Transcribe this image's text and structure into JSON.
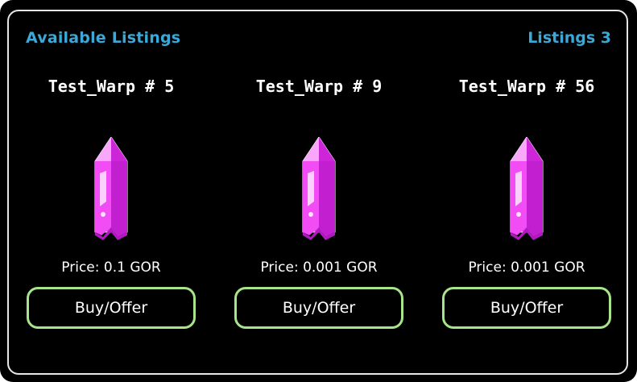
{
  "header": {
    "title": "Available Listings",
    "count_label": "Listings 3"
  },
  "listings": [
    {
      "name": "Test_Warp # 5",
      "price": "Price: 0.1 GOR",
      "button_label": "Buy/Offer",
      "image": "pink-crystal-icon"
    },
    {
      "name": "Test_Warp # 9",
      "price": "Price: 0.001 GOR",
      "button_label": "Buy/Offer",
      "image": "pink-crystal-icon"
    },
    {
      "name": "Test_Warp # 56",
      "price": "Price: 0.001 GOR",
      "button_label": "Buy/Offer",
      "image": "pink-crystal-icon"
    }
  ],
  "colors": {
    "accent": "#3aa9d9",
    "button_border": "#a8e48a",
    "crystal": "#e23be6",
    "background": "#000000"
  }
}
